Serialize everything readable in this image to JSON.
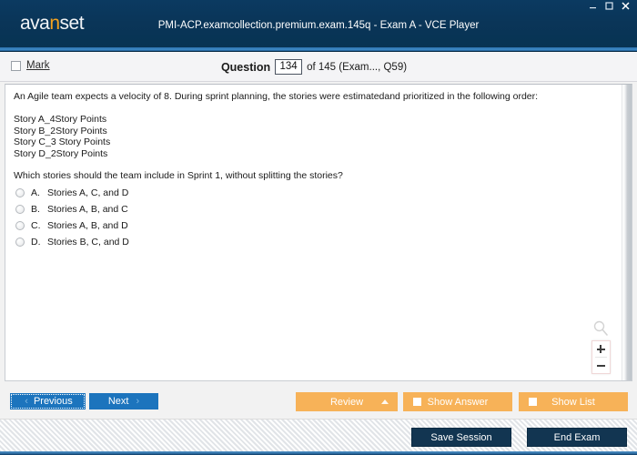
{
  "window": {
    "brand": "avanset",
    "brand_highlight_char": "n",
    "title": "PMI-ACP.examcollection.premium.exam.145q - Exam A - VCE Player",
    "controls": [
      {
        "name": "minimize",
        "glyph": "–"
      },
      {
        "name": "maximize",
        "glyph": "▫"
      },
      {
        "name": "close",
        "glyph": "✕"
      }
    ],
    "accent_blue": "#0a3558",
    "accent_orange": "#f5a21e"
  },
  "toolbar": {
    "mark_label": "Mark",
    "mark_checked": false,
    "question_label": "Question",
    "question_number": "134",
    "question_rest": "of 145 (Exam..., Q59)"
  },
  "question": {
    "stem": "An Agile team expects a velocity of 8. During sprint planning, the stories were estimatedand prioritized in the following order:",
    "stories": [
      "Story A_4Story Points",
      "Story B_2Story Points",
      "Story C_3 Story Points",
      "Story D_2Story Points"
    ],
    "sub_question": "Which stories should the team include in Sprint 1, without splitting the stories?",
    "options": [
      {
        "letter": "A.",
        "text": "Stories A, C, and D",
        "selected": false
      },
      {
        "letter": "B.",
        "text": "Stories A, B, and C",
        "selected": false
      },
      {
        "letter": "C.",
        "text": "Stories A, B, and D",
        "selected": false
      },
      {
        "letter": "D.",
        "text": "Stories B, C, and D",
        "selected": false
      }
    ]
  },
  "zoom_widget": {
    "magnifier_icon": "magnifier-icon",
    "zoom_in_label": "+",
    "zoom_out_label": "−"
  },
  "actions": {
    "previous_label": "Previous",
    "previous_arrow": "‹",
    "next_label": "Next",
    "next_arrow": "›",
    "review_label": "Review",
    "show_answer_label": "Show Answer",
    "show_list_label": "Show List",
    "orange_color": "#f7b258",
    "blue_color": "#1c74bd"
  },
  "status": {
    "save_session_label": "Save Session",
    "end_exam_label": "End Exam",
    "dark_color": "#123551"
  }
}
